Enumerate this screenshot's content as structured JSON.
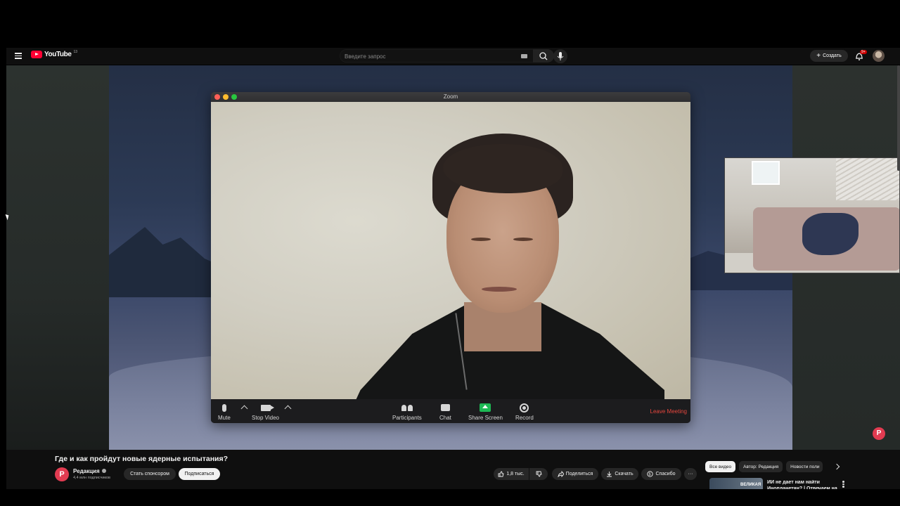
{
  "youtube": {
    "logo_text": "YouTube",
    "logo_sup": "13",
    "search_placeholder": "Введите запрос",
    "create_label": "Создать",
    "notifications_badge": "9+"
  },
  "zoom": {
    "window_title": "Zoom",
    "controls": {
      "mute": "Mute",
      "stop_video": "Stop Video",
      "participants": "Participants",
      "chat": "Chat",
      "share_screen": "Share Screen",
      "record": "Record",
      "leave": "Leave Meeting"
    },
    "share_color": "#1db954",
    "leave_color": "#e5463d"
  },
  "video": {
    "title": "Где и как пройдут новые ядерные испытания?",
    "channel_name": "Редакция",
    "channel_initial": "P",
    "subscribers": "4,4 млн подписчиков",
    "sponsor_label": "Стать спонсором",
    "subscribe_label": "Подписаться",
    "likes": "1,8 тыс.",
    "share_label": "Поделиться",
    "download_label": "Скачать",
    "thanks_label": "Спасибо",
    "more_label": "···"
  },
  "chips": [
    "Все видео",
    "Автор: Редакция",
    "Новости поли"
  ],
  "recommendation": {
    "thumb_text": "ВЕЛИКАЯ",
    "title": "ИИ не дает нам найти Инопланетян? | Отвечаем на"
  },
  "colors": {
    "brand_red": "#ff0033",
    "channel_accent": "#e23b51",
    "background": "#0f0f0f"
  }
}
